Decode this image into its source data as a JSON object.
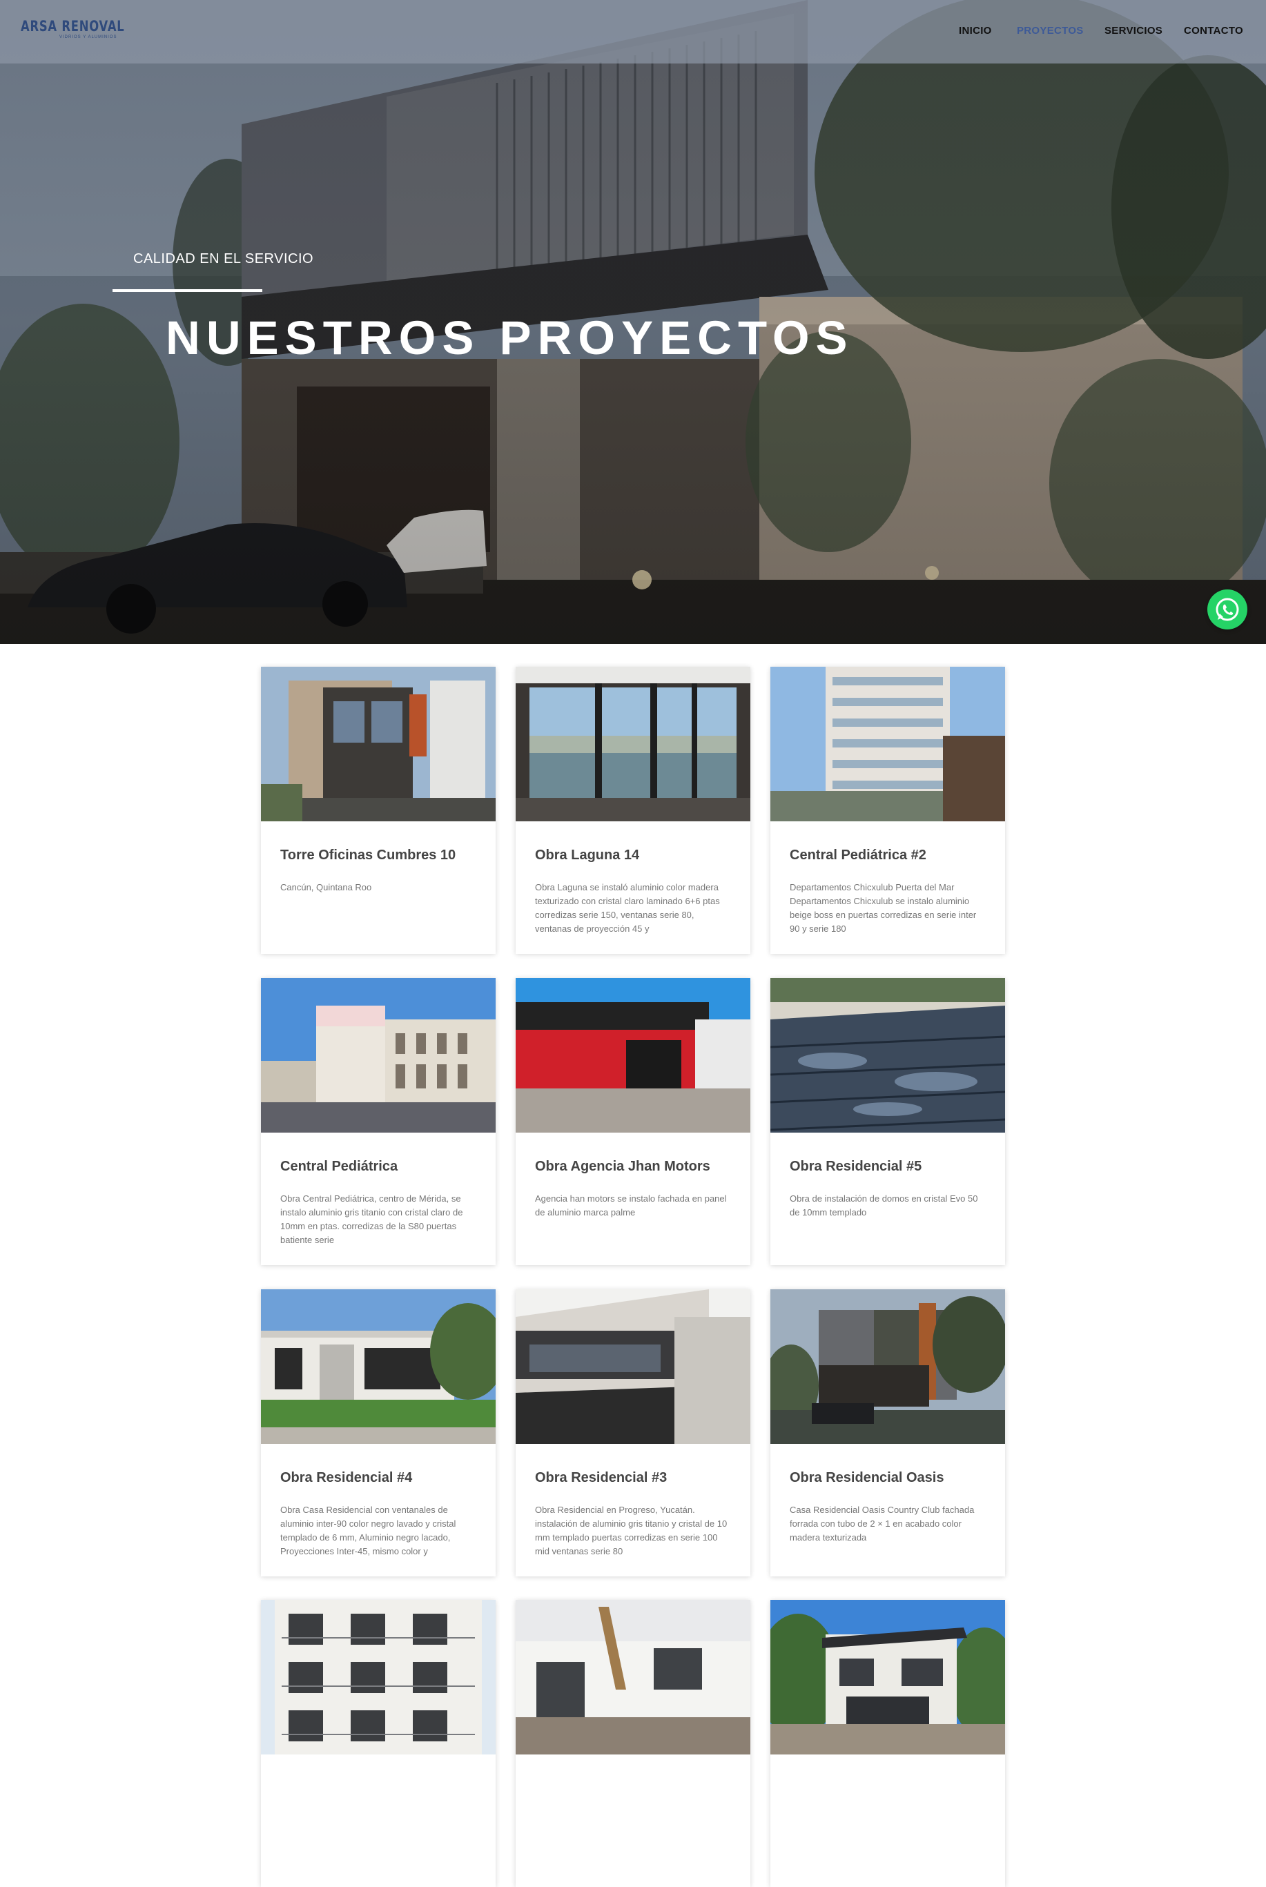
{
  "brand": {
    "name": "ARSA RENOVAL",
    "tagline": "VIDRIOS Y ALUMINIOS"
  },
  "nav": {
    "items": [
      {
        "label": "INICIO",
        "active": false
      },
      {
        "label": "PROYECTOS",
        "active": true
      },
      {
        "label": "SERVICIOS",
        "active": false
      },
      {
        "label": "CONTACTO",
        "active": false
      }
    ]
  },
  "hero": {
    "kicker": "CALIDAD EN EL SERVICIO",
    "title": "NUESTROS PROYECTOS"
  },
  "whatsapp": {
    "icon": "whatsapp-icon",
    "color": "#25d366"
  },
  "colors": {
    "accent": "#3d5a98",
    "brand": "#2f4a7c"
  },
  "projects": [
    {
      "title": "Torre Oficinas Cumbres 10",
      "description": " Cancún, Quintana Roo",
      "image": "modern-townhouse"
    },
    {
      "title": "Obra Laguna 14",
      "description": "Obra  Laguna se instaló aluminio color madera texturizado con cristal claro laminado 6+6 ptas corredizas serie 150, ventanas serie 80, ventanas de proyección 45 y",
      "image": "window-lagoon-view"
    },
    {
      "title": "Central Pediátrica #2",
      "description": "Departamentos Chicxulub Puerta del Mar Departamentos Chicxulub se instalo aluminio beige boss en puertas corredizas en serie inter 90 y serie 180",
      "image": "apartment-tower"
    },
    {
      "title": "Central Pediátrica",
      "description": "Obra Central Pediátrica, centro de Mérida, se instalo aluminio gris titanio con cristal claro de 10mm en ptas. corredizas de la S80 puertas batiente serie",
      "image": "colonial-building"
    },
    {
      "title": "Obra Agencia Jhan Motors",
      "description": "Agencia han motors se instalo fachada en panel de aluminio marca palme",
      "image": "red-dealership"
    },
    {
      "title": "Obra Residencial #5",
      "description": "Obra de instalación de domos en cristal Evo 50 de 10mm templado",
      "image": "glass-dome"
    },
    {
      "title": "Obra Residencial #4",
      "description": "Obra Casa Residencial con ventanales de aluminio inter-90  color negro lavado y cristal templado de 6 mm, Aluminio negro lacado, Proyecciones Inter-45, mismo color y",
      "image": "single-story-house"
    },
    {
      "title": "Obra Residencial #3",
      "description": "Obra Residencial en Progreso,  Yucatán. instalación de aluminio gris titanio y cristal de 10 mm templado puertas corredizas en serie 100 mid ventanas serie 80",
      "image": "modern-white-house"
    },
    {
      "title": "Obra Residencial Oasis",
      "description": "Casa Residencial Oasis Country Club fachada forrada con tubo de 2 × 1 en acabado color madera texturizada",
      "image": "dusk-residence"
    },
    {
      "title": "",
      "description": "",
      "image": "white-apartments"
    },
    {
      "title": "",
      "description": "",
      "image": "construction-site"
    },
    {
      "title": "",
      "description": "",
      "image": "tropical-villa"
    }
  ]
}
